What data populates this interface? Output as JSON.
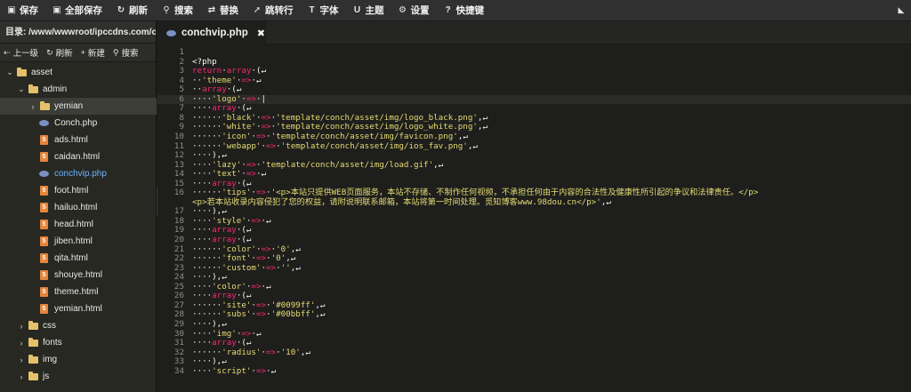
{
  "toolbar": {
    "buttons": [
      {
        "label": "保存",
        "icon": "save-icon",
        "glyph": "▣"
      },
      {
        "label": "全部保存",
        "icon": "save-all-icon",
        "glyph": "▣"
      },
      {
        "label": "刷新",
        "icon": "refresh-icon",
        "glyph": "↻"
      },
      {
        "label": "搜索",
        "icon": "search-icon",
        "glyph": "⚲"
      },
      {
        "label": "替换",
        "icon": "replace-icon",
        "glyph": "⇄"
      },
      {
        "label": "跳转行",
        "icon": "goto-line-icon",
        "glyph": "➚"
      },
      {
        "label": "字体",
        "icon": "font-icon",
        "glyph": "T"
      },
      {
        "label": "主题",
        "icon": "theme-icon",
        "glyph": "U"
      },
      {
        "label": "设置",
        "icon": "gear-icon",
        "glyph": "⚙"
      },
      {
        "label": "快捷键",
        "icon": "help-icon",
        "glyph": "?"
      }
    ],
    "collapse_icon": "collapse-icon"
  },
  "sidebar": {
    "dir_label": "目录: /www/wwwroot/ipccdns.com/co...",
    "actions": [
      {
        "label": "上一级",
        "icon": "up-level-icon",
        "glyph": "⇠"
      },
      {
        "label": "刷新",
        "icon": "refresh-icon",
        "glyph": "↻"
      },
      {
        "label": "新建",
        "icon": "new-file-icon",
        "glyph": "+"
      },
      {
        "label": "搜索",
        "icon": "search-icon",
        "glyph": "⚲"
      }
    ],
    "tree": [
      {
        "name": "asset",
        "type": "folder",
        "depth": 0,
        "open": true
      },
      {
        "name": "admin",
        "type": "folder",
        "depth": 1,
        "open": true
      },
      {
        "name": "yemian",
        "type": "folder",
        "depth": 2,
        "open": false,
        "selected": true
      },
      {
        "name": "Conch.php",
        "type": "php",
        "depth": 2
      },
      {
        "name": "ads.html",
        "type": "html",
        "depth": 2
      },
      {
        "name": "caidan.html",
        "type": "html",
        "depth": 2
      },
      {
        "name": "conchvip.php",
        "type": "php",
        "depth": 2,
        "active": true
      },
      {
        "name": "foot.html",
        "type": "html",
        "depth": 2
      },
      {
        "name": "hailuo.html",
        "type": "html",
        "depth": 2
      },
      {
        "name": "head.html",
        "type": "html",
        "depth": 2
      },
      {
        "name": "jiben.html",
        "type": "html",
        "depth": 2
      },
      {
        "name": "qita.html",
        "type": "html",
        "depth": 2
      },
      {
        "name": "shouye.html",
        "type": "html",
        "depth": 2
      },
      {
        "name": "theme.html",
        "type": "html",
        "depth": 2
      },
      {
        "name": "yemian.html",
        "type": "html",
        "depth": 2
      },
      {
        "name": "css",
        "type": "folder",
        "depth": 1,
        "open": false
      },
      {
        "name": "fonts",
        "type": "folder",
        "depth": 1,
        "open": false
      },
      {
        "name": "img",
        "type": "folder",
        "depth": 1,
        "open": false
      },
      {
        "name": "js",
        "type": "folder",
        "depth": 1,
        "open": false
      }
    ]
  },
  "handle": {
    "label": "❮"
  },
  "tab": {
    "label": "conchvip.php",
    "close": "✖"
  },
  "editor": {
    "current_line": 6,
    "lines": [
      {
        "n": "1",
        "segs": []
      },
      {
        "n": "2",
        "segs": [
          [
            "php",
            "<?php"
          ]
        ]
      },
      {
        "n": "3",
        "segs": [
          [
            "kw",
            "return"
          ],
          [
            "ws",
            "·"
          ],
          [
            "kw",
            "array"
          ],
          [
            "ws",
            "·"
          ],
          [
            "p",
            "("
          ],
          [
            "ws",
            "↵"
          ]
        ]
      },
      {
        "n": "4",
        "segs": [
          [
            "ws",
            "··"
          ],
          [
            "str",
            "'theme'"
          ],
          [
            "ws",
            "·"
          ],
          [
            "op",
            "=>"
          ],
          [
            "ws",
            "·↵"
          ]
        ]
      },
      {
        "n": "5",
        "segs": [
          [
            "ws",
            "··"
          ],
          [
            "kw",
            "array"
          ],
          [
            "ws",
            "·"
          ],
          [
            "p",
            "("
          ],
          [
            "ws",
            "↵"
          ]
        ]
      },
      {
        "n": "6",
        "segs": [
          [
            "ws",
            "····"
          ],
          [
            "str",
            "'logo'"
          ],
          [
            "ws",
            "·"
          ],
          [
            "op",
            "=>"
          ],
          [
            "ws",
            "·"
          ],
          [
            "p",
            "|"
          ]
        ]
      },
      {
        "n": "7",
        "segs": [
          [
            "ws",
            "····"
          ],
          [
            "kw",
            "array"
          ],
          [
            "ws",
            "·"
          ],
          [
            "p",
            "("
          ],
          [
            "ws",
            "↵"
          ]
        ]
      },
      {
        "n": "8",
        "segs": [
          [
            "ws",
            "······"
          ],
          [
            "str",
            "'black'"
          ],
          [
            "ws",
            "·"
          ],
          [
            "op",
            "=>"
          ],
          [
            "ws",
            "·"
          ],
          [
            "str",
            "'template/conch/asset/img/logo_black.png'"
          ],
          [
            "p",
            ","
          ],
          [
            "ws",
            "↵"
          ]
        ]
      },
      {
        "n": "9",
        "segs": [
          [
            "ws",
            "······"
          ],
          [
            "str",
            "'white'"
          ],
          [
            "ws",
            "·"
          ],
          [
            "op",
            "=>"
          ],
          [
            "ws",
            "·"
          ],
          [
            "str",
            "'template/conch/asset/img/logo_white.png'"
          ],
          [
            "p",
            ","
          ],
          [
            "ws",
            "↵"
          ]
        ]
      },
      {
        "n": "10",
        "segs": [
          [
            "ws",
            "······"
          ],
          [
            "str",
            "'icon'"
          ],
          [
            "ws",
            "·"
          ],
          [
            "op",
            "=>"
          ],
          [
            "ws",
            "·"
          ],
          [
            "str",
            "'template/conch/asset/img/favicon.png'"
          ],
          [
            "p",
            ","
          ],
          [
            "ws",
            "↵"
          ]
        ]
      },
      {
        "n": "11",
        "segs": [
          [
            "ws",
            "······"
          ],
          [
            "str",
            "'webapp'"
          ],
          [
            "ws",
            "·"
          ],
          [
            "op",
            "=>"
          ],
          [
            "ws",
            "·"
          ],
          [
            "str",
            "'template/conch/asset/img/ios_fav.png'"
          ],
          [
            "p",
            ","
          ],
          [
            "ws",
            "↵"
          ]
        ]
      },
      {
        "n": "12",
        "segs": [
          [
            "ws",
            "····"
          ],
          [
            "p",
            "),"
          ],
          [
            "ws",
            "↵"
          ]
        ]
      },
      {
        "n": "13",
        "segs": [
          [
            "ws",
            "····"
          ],
          [
            "str",
            "'lazy'"
          ],
          [
            "ws",
            "·"
          ],
          [
            "op",
            "=>"
          ],
          [
            "ws",
            "·"
          ],
          [
            "str",
            "'template/conch/asset/img/load.gif'"
          ],
          [
            "p",
            ","
          ],
          [
            "ws",
            "↵"
          ]
        ]
      },
      {
        "n": "14",
        "segs": [
          [
            "ws",
            "····"
          ],
          [
            "str",
            "'text'"
          ],
          [
            "ws",
            "·"
          ],
          [
            "op",
            "=>"
          ],
          [
            "ws",
            "·↵"
          ]
        ]
      },
      {
        "n": "15",
        "segs": [
          [
            "ws",
            "····"
          ],
          [
            "kw",
            "array"
          ],
          [
            "ws",
            "·"
          ],
          [
            "p",
            "("
          ],
          [
            "ws",
            "↵"
          ]
        ]
      },
      {
        "n": "16",
        "segs": [
          [
            "ws",
            "······"
          ],
          [
            "str",
            "'tips'"
          ],
          [
            "ws",
            "·"
          ],
          [
            "op",
            "=>"
          ],
          [
            "ws",
            "·"
          ],
          [
            "str",
            "'<p>本站只提供WEB页面服务，本站不存储、不制作任何视频，不承担任何由于内容的合法性及健康性所引起的争议和法律责任。</p>"
          ]
        ]
      },
      {
        "n": "",
        "segs": [
          [
            "str",
            "<p>若本站收录内容侵犯了您的权益，请附说明联系邮箱，本站将第一时间处理。觅知博客www.98dou.cn</p>'"
          ],
          [
            "p",
            ","
          ],
          [
            "ws",
            "↵"
          ]
        ]
      },
      {
        "n": "17",
        "segs": [
          [
            "ws",
            "····"
          ],
          [
            "p",
            "),"
          ],
          [
            "ws",
            "↵"
          ]
        ]
      },
      {
        "n": "18",
        "segs": [
          [
            "ws",
            "····"
          ],
          [
            "str",
            "'style'"
          ],
          [
            "ws",
            "·"
          ],
          [
            "op",
            "=>"
          ],
          [
            "ws",
            "·↵"
          ]
        ]
      },
      {
        "n": "19",
        "segs": [
          [
            "ws",
            "····"
          ],
          [
            "kw",
            "array"
          ],
          [
            "ws",
            "·"
          ],
          [
            "p",
            "("
          ],
          [
            "ws",
            "↵"
          ]
        ]
      },
      {
        "n": "20",
        "segs": [
          [
            "ws",
            "····"
          ],
          [
            "kw",
            "array"
          ],
          [
            "ws",
            "·"
          ],
          [
            "p",
            "("
          ],
          [
            "ws",
            "↵"
          ]
        ]
      },
      {
        "n": "21",
        "segs": [
          [
            "ws",
            "······"
          ],
          [
            "str",
            "'color'"
          ],
          [
            "ws",
            "·"
          ],
          [
            "op",
            "=>"
          ],
          [
            "ws",
            "·"
          ],
          [
            "str",
            "'0'"
          ],
          [
            "p",
            ","
          ],
          [
            "ws",
            "↵"
          ]
        ]
      },
      {
        "n": "22",
        "segs": [
          [
            "ws",
            "······"
          ],
          [
            "str",
            "'font'"
          ],
          [
            "ws",
            "·"
          ],
          [
            "op",
            "=>"
          ],
          [
            "ws",
            "·"
          ],
          [
            "str",
            "'0'"
          ],
          [
            "p",
            ","
          ],
          [
            "ws",
            "↵"
          ]
        ]
      },
      {
        "n": "23",
        "segs": [
          [
            "ws",
            "······"
          ],
          [
            "str",
            "'custom'"
          ],
          [
            "ws",
            "·"
          ],
          [
            "op",
            "=>"
          ],
          [
            "ws",
            "·"
          ],
          [
            "str",
            "''"
          ],
          [
            "p",
            ","
          ],
          [
            "ws",
            "↵"
          ]
        ]
      },
      {
        "n": "24",
        "segs": [
          [
            "ws",
            "····"
          ],
          [
            "p",
            "),"
          ],
          [
            "ws",
            "↵"
          ]
        ]
      },
      {
        "n": "25",
        "segs": [
          [
            "ws",
            "····"
          ],
          [
            "str",
            "'color'"
          ],
          [
            "ws",
            "·"
          ],
          [
            "op",
            "=>"
          ],
          [
            "ws",
            "·↵"
          ]
        ]
      },
      {
        "n": "26",
        "segs": [
          [
            "ws",
            "····"
          ],
          [
            "kw",
            "array"
          ],
          [
            "ws",
            "·"
          ],
          [
            "p",
            "("
          ],
          [
            "ws",
            "↵"
          ]
        ]
      },
      {
        "n": "27",
        "segs": [
          [
            "ws",
            "······"
          ],
          [
            "str",
            "'site'"
          ],
          [
            "ws",
            "·"
          ],
          [
            "op",
            "=>"
          ],
          [
            "ws",
            "·"
          ],
          [
            "str",
            "'#0099ff'"
          ],
          [
            "p",
            ","
          ],
          [
            "ws",
            "↵"
          ]
        ]
      },
      {
        "n": "28",
        "segs": [
          [
            "ws",
            "······"
          ],
          [
            "str",
            "'subs'"
          ],
          [
            "ws",
            "·"
          ],
          [
            "op",
            "=>"
          ],
          [
            "ws",
            "·"
          ],
          [
            "str",
            "'#00bbff'"
          ],
          [
            "p",
            ","
          ],
          [
            "ws",
            "↵"
          ]
        ]
      },
      {
        "n": "29",
        "segs": [
          [
            "ws",
            "····"
          ],
          [
            "p",
            "),"
          ],
          [
            "ws",
            "↵"
          ]
        ]
      },
      {
        "n": "30",
        "segs": [
          [
            "ws",
            "····"
          ],
          [
            "str",
            "'img'"
          ],
          [
            "ws",
            "·"
          ],
          [
            "op",
            "=>"
          ],
          [
            "ws",
            "·↵"
          ]
        ]
      },
      {
        "n": "31",
        "segs": [
          [
            "ws",
            "····"
          ],
          [
            "kw",
            "array"
          ],
          [
            "ws",
            "·"
          ],
          [
            "p",
            "("
          ],
          [
            "ws",
            "↵"
          ]
        ]
      },
      {
        "n": "32",
        "segs": [
          [
            "ws",
            "······"
          ],
          [
            "str",
            "'radius'"
          ],
          [
            "ws",
            "·"
          ],
          [
            "op",
            "=>"
          ],
          [
            "ws",
            "·"
          ],
          [
            "str",
            "'10'"
          ],
          [
            "p",
            ","
          ],
          [
            "ws",
            "↵"
          ]
        ]
      },
      {
        "n": "33",
        "segs": [
          [
            "ws",
            "····"
          ],
          [
            "p",
            "),"
          ],
          [
            "ws",
            "↵"
          ]
        ]
      },
      {
        "n": "34",
        "segs": [
          [
            "ws",
            "····"
          ],
          [
            "str",
            "'script'"
          ],
          [
            "ws",
            "·"
          ],
          [
            "op",
            "=>"
          ],
          [
            "ws",
            "·↵"
          ]
        ]
      }
    ]
  }
}
